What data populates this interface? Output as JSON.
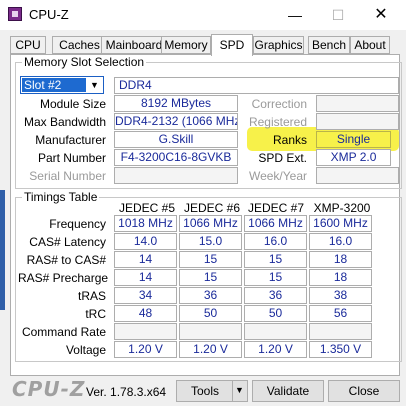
{
  "window": {
    "title": "CPU-Z",
    "minimize_glyph": "—",
    "maximize_glyph": "☐",
    "close_glyph": "✕"
  },
  "tabs": [
    "CPU",
    "Caches",
    "Mainboard",
    "Memory",
    "SPD",
    "Graphics",
    "Bench",
    "About"
  ],
  "active_tab": "SPD",
  "memory_slot": {
    "group_title": "Memory Slot Selection",
    "slot_value": "Slot #2",
    "dropdown_arrow": "▼",
    "type_value": "DDR4",
    "module_size_label": "Module Size",
    "module_size_value": "8192 MBytes",
    "max_bandwidth_label": "Max Bandwidth",
    "max_bandwidth_value": "DDR4-2132 (1066 MHz)",
    "manufacturer_label": "Manufacturer",
    "manufacturer_value": "G.Skill",
    "part_number_label": "Part Number",
    "part_number_value": "F4-3200C16-8GVKB",
    "serial_number_label": "Serial Number",
    "serial_number_value": "",
    "correction_label": "Correction",
    "correction_value": "",
    "registered_label": "Registered",
    "registered_value": "",
    "ranks_label": "Ranks",
    "ranks_value": "Single",
    "spd_ext_label": "SPD Ext.",
    "spd_ext_value": "XMP 2.0",
    "week_year_label": "Week/Year",
    "week_year_value": ""
  },
  "timings": {
    "group_title": "Timings Table",
    "columns": [
      "JEDEC #5",
      "JEDEC #6",
      "JEDEC #7",
      "XMP-3200"
    ],
    "rows": [
      {
        "label": "Frequency",
        "values": [
          "1018 MHz",
          "1066 MHz",
          "1066 MHz",
          "1600 MHz"
        ]
      },
      {
        "label": "CAS# Latency",
        "values": [
          "14.0",
          "15.0",
          "16.0",
          "16.0"
        ]
      },
      {
        "label": "RAS# to CAS#",
        "values": [
          "14",
          "15",
          "15",
          "18"
        ]
      },
      {
        "label": "RAS# Precharge",
        "values": [
          "14",
          "15",
          "15",
          "18"
        ]
      },
      {
        "label": "tRAS",
        "values": [
          "34",
          "36",
          "36",
          "38"
        ]
      },
      {
        "label": "tRC",
        "values": [
          "48",
          "50",
          "50",
          "56"
        ]
      },
      {
        "label": "Command Rate",
        "values": [
          "",
          "",
          "",
          ""
        ]
      },
      {
        "label": "Voltage",
        "values": [
          "1.20 V",
          "1.20 V",
          "1.20 V",
          "1.350 V"
        ]
      }
    ]
  },
  "footer": {
    "logo": "CPU-Z",
    "version": "Ver. 1.78.3.x64",
    "tools_label": "Tools",
    "tools_arrow": "▼",
    "validate_label": "Validate",
    "close_label": "Close"
  },
  "colors": {
    "value_text": "#1a2a9a",
    "highlight": "#f7f14a",
    "selection": "#1e6ad0"
  }
}
